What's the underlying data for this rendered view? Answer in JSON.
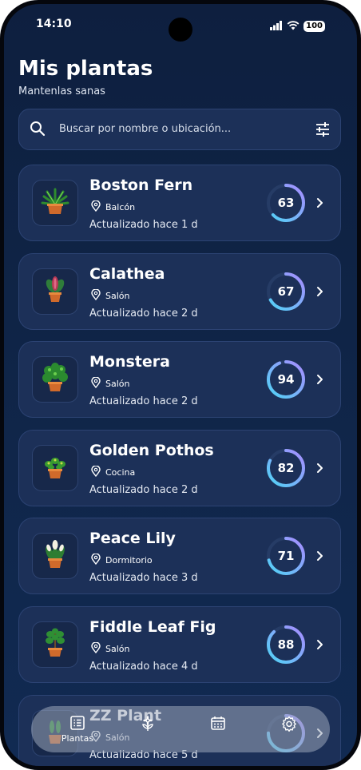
{
  "status_bar": {
    "time": "14:10",
    "battery": "100"
  },
  "header": {
    "title": "Mis plantas",
    "subtitle": "Mantenlas sanas"
  },
  "search": {
    "placeholder": "Buscar por nombre o ubicación..."
  },
  "plants": [
    {
      "name": "Boston Fern",
      "location": "Balcón",
      "updated": "Actualizado hace 1 d",
      "score": "63",
      "score_value": 63
    },
    {
      "name": "Calathea",
      "location": "Salón",
      "updated": "Actualizado hace 2 d",
      "score": "67",
      "score_value": 67
    },
    {
      "name": "Monstera",
      "location": "Salón",
      "updated": "Actualizado hace 2 d",
      "score": "94",
      "score_value": 94
    },
    {
      "name": "Golden Pothos",
      "location": "Cocina",
      "updated": "Actualizado hace 2 d",
      "score": "82",
      "score_value": 82
    },
    {
      "name": "Peace Lily",
      "location": "Dormitorio",
      "updated": "Actualizado hace 3 d",
      "score": "71",
      "score_value": 71
    },
    {
      "name": "Fiddle Leaf Fig",
      "location": "Salón",
      "updated": "Actualizado hace 4 d",
      "score": "88",
      "score_value": 88
    },
    {
      "name": "ZZ Plant",
      "location": "Salón",
      "updated": "Actualizado hace 5 d",
      "score": "",
      "score_value": 75
    }
  ],
  "nav": {
    "plants_label": "Plantas"
  },
  "colors": {
    "accent_cyan": "#4fd3f5",
    "accent_violet": "#a98bff",
    "background": "#0f2446",
    "card": "#1c3058"
  }
}
